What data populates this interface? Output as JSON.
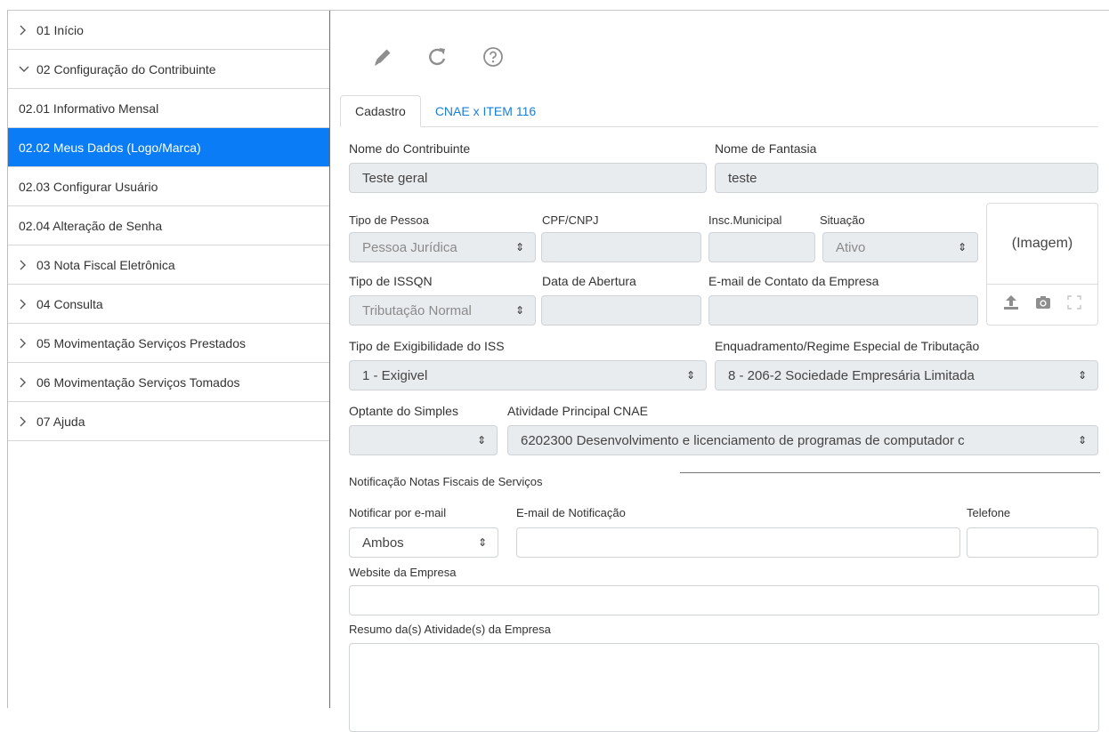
{
  "sidebar": {
    "items": [
      {
        "label": "01 Início",
        "chevron": "right"
      },
      {
        "label": "02 Configuração do Contribuinte",
        "chevron": "down"
      },
      {
        "label": "02.01 Informativo Mensal"
      },
      {
        "label": "02.02 Meus Dados (Logo/Marca)",
        "active": true
      },
      {
        "label": "02.03 Configurar Usuário"
      },
      {
        "label": "02.04 Alteração de Senha"
      },
      {
        "label": "03 Nota Fiscal Eletrônica",
        "chevron": "right"
      },
      {
        "label": "04 Consulta",
        "chevron": "right"
      },
      {
        "label": "05 Movimentação Serviços Prestados",
        "chevron": "right"
      },
      {
        "label": "06 Movimentação Serviços Tomados",
        "chevron": "right"
      },
      {
        "label": "07 Ajuda",
        "chevron": "right"
      }
    ]
  },
  "toolbar": {
    "icons": [
      "pencil-icon",
      "refresh-icon",
      "help-icon"
    ],
    "icon_color": "#8e8e8e"
  },
  "tabs": [
    {
      "label": "Cadastro",
      "active": true
    },
    {
      "label": "CNAE x ITEM 116"
    }
  ],
  "form": {
    "nome_contribuinte": {
      "label": "Nome do Contribuinte",
      "value": "Teste geral"
    },
    "nome_fantasia": {
      "label": "Nome de Fantasia",
      "value": "teste"
    },
    "tipo_pessoa": {
      "label": "Tipo de Pessoa",
      "value": "Pessoa Jurídica"
    },
    "cpf_cnpj": {
      "label": "CPF/CNPJ",
      "value": ""
    },
    "insc_municipal": {
      "label": "Insc.Municipal",
      "value": ""
    },
    "situacao": {
      "label": "Situação",
      "value": "Ativo"
    },
    "tipo_issqn": {
      "label": "Tipo de ISSQN",
      "value": "Tributação Normal"
    },
    "data_abertura": {
      "label": "Data de Abertura",
      "value": ""
    },
    "email_contato": {
      "label": "E-mail de Contato da Empresa",
      "value": ""
    },
    "imagem": {
      "label": "(Imagem)"
    },
    "exigibilidade": {
      "label": "Tipo de Exigibilidade do ISS",
      "value": "1 - Exigivel"
    },
    "enquadramento": {
      "label": "Enquadramento/Regime Especial de Tributação",
      "value": "8 - 206-2 Sociedade Empresária Limitada"
    },
    "optante_simples": {
      "label": "Optante do Simples",
      "value": ""
    },
    "atividade_cnae": {
      "label": "Atividade Principal CNAE",
      "value": "6202300 Desenvolvimento e licenciamento de programas de computador c"
    },
    "notificacao_section": "Notificação Notas Fiscais de Serviços",
    "notificar_email": {
      "label": "Notificar por e-mail",
      "value": "Ambos"
    },
    "email_notificacao": {
      "label": "E-mail de Notificação",
      "value": ""
    },
    "telefone": {
      "label": "Telefone",
      "value": ""
    },
    "website": {
      "label": "Website da Empresa",
      "value": ""
    },
    "resumo": {
      "label": "Resumo da(s) Atividade(s) da Empresa",
      "value": ""
    }
  },
  "colors": {
    "accent": "#0a7cf5",
    "link": "#1a7fd6",
    "readonly_bg": "#e9ecef"
  }
}
